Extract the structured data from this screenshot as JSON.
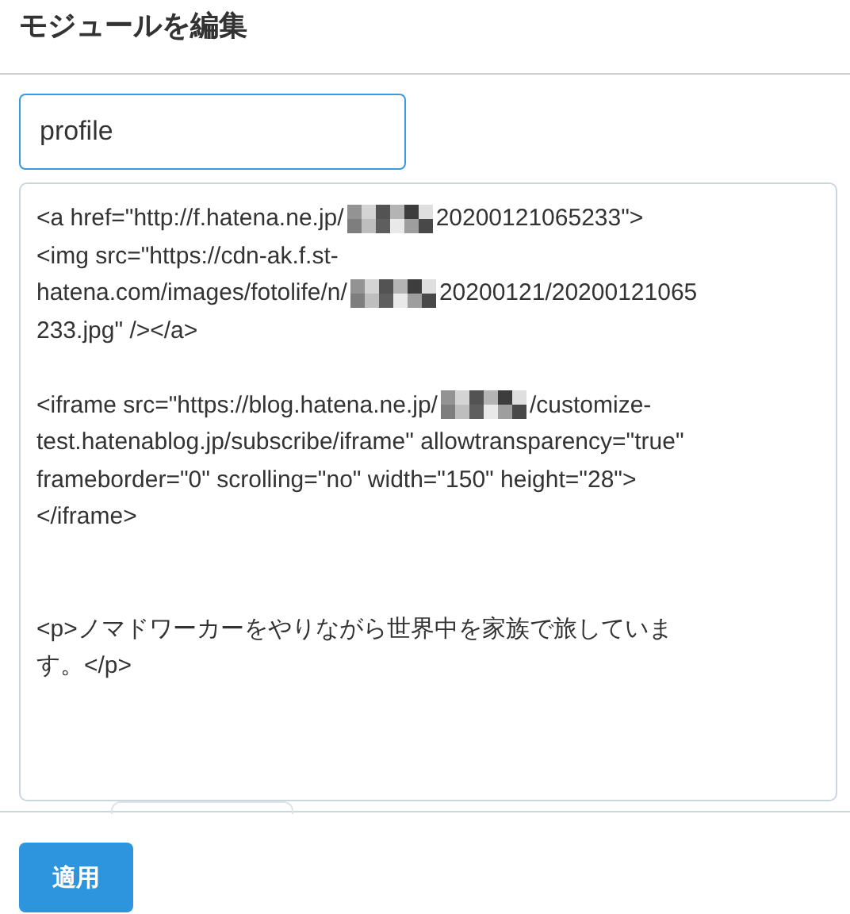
{
  "title": "モジュールを編集",
  "name_field": {
    "value": "profile"
  },
  "content_field": {
    "paragraphs": [
      {
        "kind": "spaced",
        "lines": [
          [
            {
              "kind": "text",
              "text": "<a href=\"http://f.hatena.ne.jp/"
            },
            {
              "kind": "redacted"
            },
            {
              "kind": "text",
              "text": "20200121065233\">"
            }
          ],
          [
            {
              "kind": "text",
              "text": "<img src=\"https://cdn-ak.f.st-"
            }
          ],
          [
            {
              "kind": "text",
              "text": "hatena.com/images/fotolife/n/"
            },
            {
              "kind": "redacted"
            },
            {
              "kind": "text",
              "text": "20200121/20200121065"
            }
          ],
          [
            {
              "kind": "text",
              "text": "233.jpg\" /></a>"
            }
          ]
        ]
      },
      {
        "kind": "widespaced",
        "lines": [
          [
            {
              "kind": "text",
              "text": "<iframe src=\"https://blog.hatena.ne.jp/"
            },
            {
              "kind": "redacted"
            },
            {
              "kind": "text",
              "text": "/customize-"
            }
          ],
          [
            {
              "kind": "text",
              "text": "test.hatenablog.jp/subscribe/iframe\" allowtransparency=\"true\""
            }
          ],
          [
            {
              "kind": "text",
              "text": "frameborder=\"0\" scrolling=\"no\" width=\"150\" height=\"28\">"
            }
          ],
          [
            {
              "kind": "text",
              "text": "</iframe>"
            }
          ]
        ]
      },
      {
        "kind": "plain",
        "lines": [
          [
            {
              "kind": "text",
              "text": "<p>ノマドワーカーをやりながら世界中を家族で旅していま"
            }
          ],
          [
            {
              "kind": "text",
              "text": "す。</p>"
            }
          ]
        ]
      }
    ]
  },
  "apply_button": {
    "label": "適用"
  }
}
